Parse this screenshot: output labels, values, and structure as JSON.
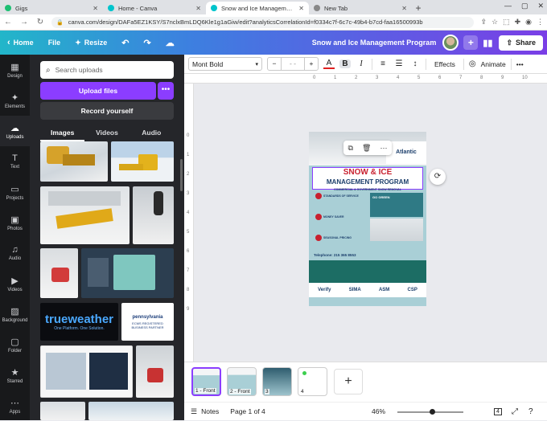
{
  "browser": {
    "tabs": [
      {
        "title": "Gigs",
        "color": "#1dbf73"
      },
      {
        "title": "Home - Canva",
        "color": "#00c4cc"
      },
      {
        "title": "Snow and Ice Management Progr",
        "color": "#00c4cc"
      },
      {
        "title": "New Tab",
        "color": "#888888"
      }
    ],
    "new_tab": "+",
    "url": "canva.com/design/DAFa5EZ1KSY/S7nclxBmLDQ6Kle1g1aGiw/edit?analyticsCorrelationId=f0334c7f-6c7c-49b4-b7cd-faa16500993b"
  },
  "topbar": {
    "home": "Home",
    "file": "File",
    "resize": "Resize",
    "title": "Snow and Ice Management Program",
    "share": "Share",
    "plus": "+"
  },
  "leftnav": [
    {
      "icon": "▦",
      "label": "Design",
      "name": "design"
    },
    {
      "icon": "✦",
      "label": "Elements",
      "name": "elements"
    },
    {
      "icon": "☁",
      "label": "Uploads",
      "name": "uploads",
      "active": true
    },
    {
      "icon": "T",
      "label": "Text",
      "name": "text"
    },
    {
      "icon": "▭",
      "label": "Projects",
      "name": "projects"
    },
    {
      "icon": "▣",
      "label": "Photos",
      "name": "photos"
    },
    {
      "icon": "♫",
      "label": "Audio",
      "name": "audio"
    },
    {
      "icon": "▶",
      "label": "Videos",
      "name": "videos"
    },
    {
      "icon": "▨",
      "label": "Background",
      "name": "background"
    },
    {
      "icon": "▢",
      "label": "Folder",
      "name": "folder"
    },
    {
      "icon": "★",
      "label": "Starred",
      "name": "starred"
    },
    {
      "icon": "⋯",
      "label": "Apps",
      "name": "apps"
    }
  ],
  "panel": {
    "search_placeholder": "Search uploads",
    "upload_label": "Upload files",
    "upload_more": "•••",
    "record_label": "Record yourself",
    "tabs": [
      "Images",
      "Videos",
      "Audio"
    ],
    "thumbs": [
      {
        "title": "trueweather",
        "subtitle": "One Platform. One Solution.",
        "kind": "logo-tw"
      },
      {
        "title": "pennsylvania",
        "subtitle": "ECMS REGISTERED BUSINESS PARTNER",
        "kind": "logo-pa"
      }
    ]
  },
  "toolbar": {
    "font": "Mont Bold",
    "size_minus": "−",
    "size_value": "- -",
    "size_plus": "+",
    "effects": "Effects",
    "animate": "Animate",
    "more": "•••"
  },
  "ruler": {
    "h": [
      "0",
      "1",
      "2",
      "3",
      "4",
      "5",
      "6",
      "7",
      "8",
      "9",
      "10"
    ],
    "v": [
      "0",
      "1",
      "2",
      "3",
      "4",
      "5",
      "6",
      "7",
      "8",
      "9"
    ]
  },
  "poster": {
    "brand": "Atlantic",
    "title1": "SNOW & ICE",
    "title2": "MANAGEMENT PROGRAM",
    "subtitle": "COMMERCIAL & GOVERNMENT SNOW REMOVAL",
    "items": [
      "STANDARDS OF SERVICE",
      "MONEY SAVER",
      "SEASONAL PRICING"
    ],
    "go_green": "GO GREEN",
    "phone": "Telephone: 215 365 8553",
    "logos": [
      "Verify",
      "SIMA",
      "ASM",
      "CSP"
    ]
  },
  "pages": [
    {
      "label": "1 - Front"
    },
    {
      "label": "2 - Front"
    },
    {
      "label": "3"
    },
    {
      "label": "4"
    }
  ],
  "footer": {
    "notes": "Notes",
    "page_of": "Page 1 of 4",
    "zoom": "46%",
    "page_count": "4",
    "zoom_fraction": 0.46
  },
  "colors": {
    "accent": "#8b3dff",
    "poster_red": "#c8202f",
    "poster_teal": "#2f7a85",
    "poster_blue": "#1b3e6b"
  }
}
